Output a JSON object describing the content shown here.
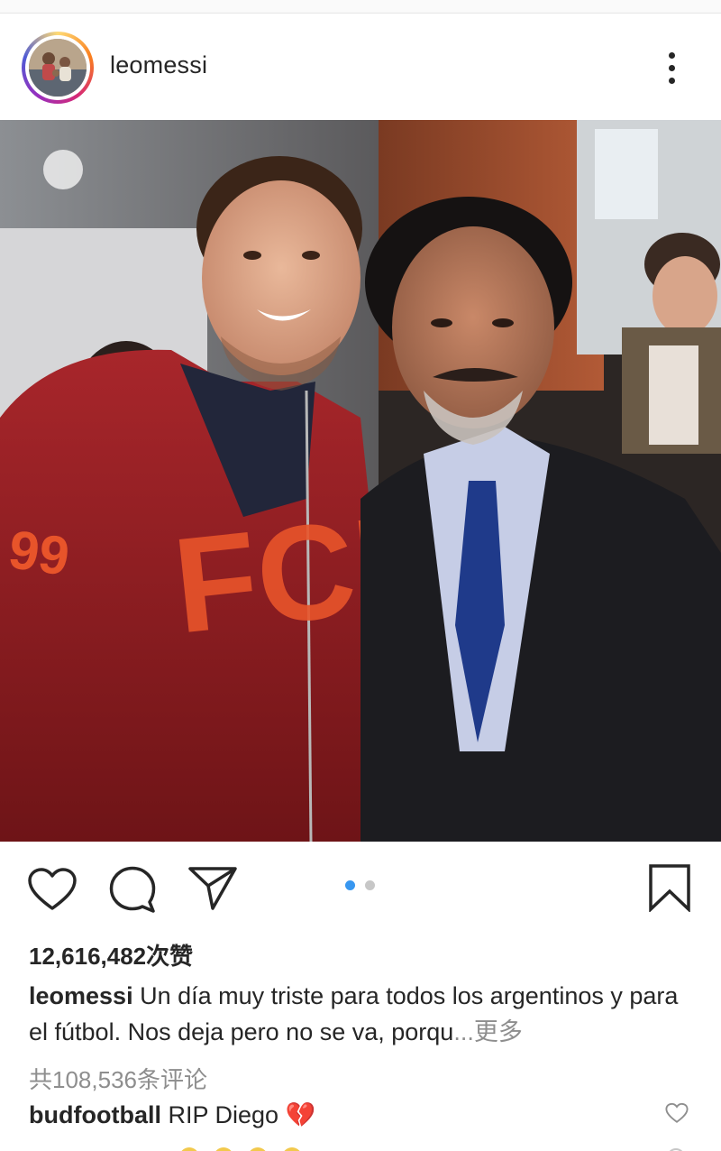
{
  "post": {
    "username": "leomessi"
  },
  "photo": {
    "left_jacket_text": "FCB",
    "sleeve_number": "99"
  },
  "actions": {
    "carousel_total": 2,
    "carousel_active_index": 0,
    "active_dot_color": "#3897f0",
    "inactive_dot_color": "#c7c7c7"
  },
  "likes": {
    "text": "12,616,482次赞"
  },
  "caption": {
    "username": "leomessi",
    "text": "Un día muy triste para todos los argentinos y para el fútbol. Nos deja pero no se va, porqu",
    "ellipsis": "...",
    "more_label": "更多"
  },
  "comments": {
    "view_all": "共108,536条评论"
  },
  "top_comment": {
    "username": "budfootball",
    "text": "RIP Diego",
    "emoji": "💔"
  }
}
